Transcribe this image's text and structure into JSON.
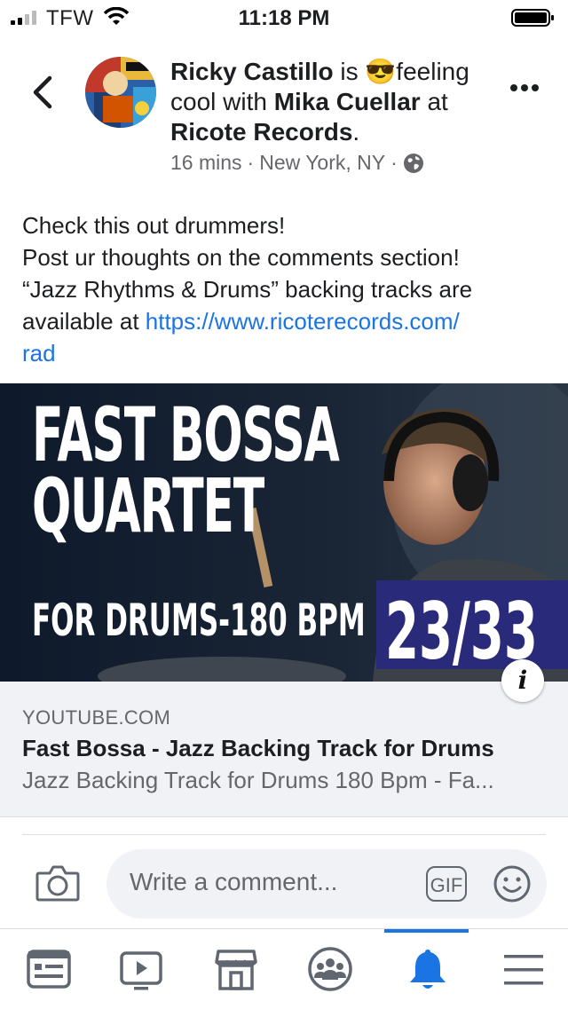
{
  "status_bar": {
    "carrier": "TFW",
    "time": "11:18 PM"
  },
  "post": {
    "author": "Ricky Castillo",
    "feeling_pre": " is ",
    "feeling_emoji": "😎",
    "feeling_text": "feeling cool with ",
    "tagged": "Mika Cuellar",
    "at_text": " at ",
    "place": "Ricote Records",
    "period": ".",
    "time_ago": "16 mins",
    "sep1": "·",
    "location": "New York, NY",
    "sep2": "·",
    "text_lines": [
      "Check this out drummers!",
      "Post ur thoughts on the comments section!",
      "“Jazz Rhythms & Drums” backing tracks are"
    ],
    "text_last_prefix": "available at ",
    "link_url_1": "https://www.ricoterecords.com/",
    "link_url_2": "rad"
  },
  "hero": {
    "title_line1": "FAST BOSSA",
    "title_line2": "QUARTET",
    "subtitle": "FOR DRUMS-180 BPM",
    "badge": "23/33"
  },
  "link_card": {
    "domain": "YOUTUBE.COM",
    "title": "Fast Bossa - Jazz Backing Track for Drums",
    "subtitle": "Jazz Backing Track for Drums 180 Bpm - Fa...",
    "info_glyph": "i"
  },
  "comment_bar": {
    "placeholder": "Write a comment...",
    "gif_label": "GIF"
  },
  "tabs": [
    {
      "name": "news-feed-icon"
    },
    {
      "name": "watch-icon"
    },
    {
      "name": "marketplace-icon"
    },
    {
      "name": "groups-icon"
    },
    {
      "name": "notifications-icon"
    },
    {
      "name": "menu-icon"
    }
  ],
  "colors": {
    "accent": "#1b74e4",
    "link": "#1b74e4",
    "muted": "#65676b",
    "badge": "#2a2a7a"
  }
}
